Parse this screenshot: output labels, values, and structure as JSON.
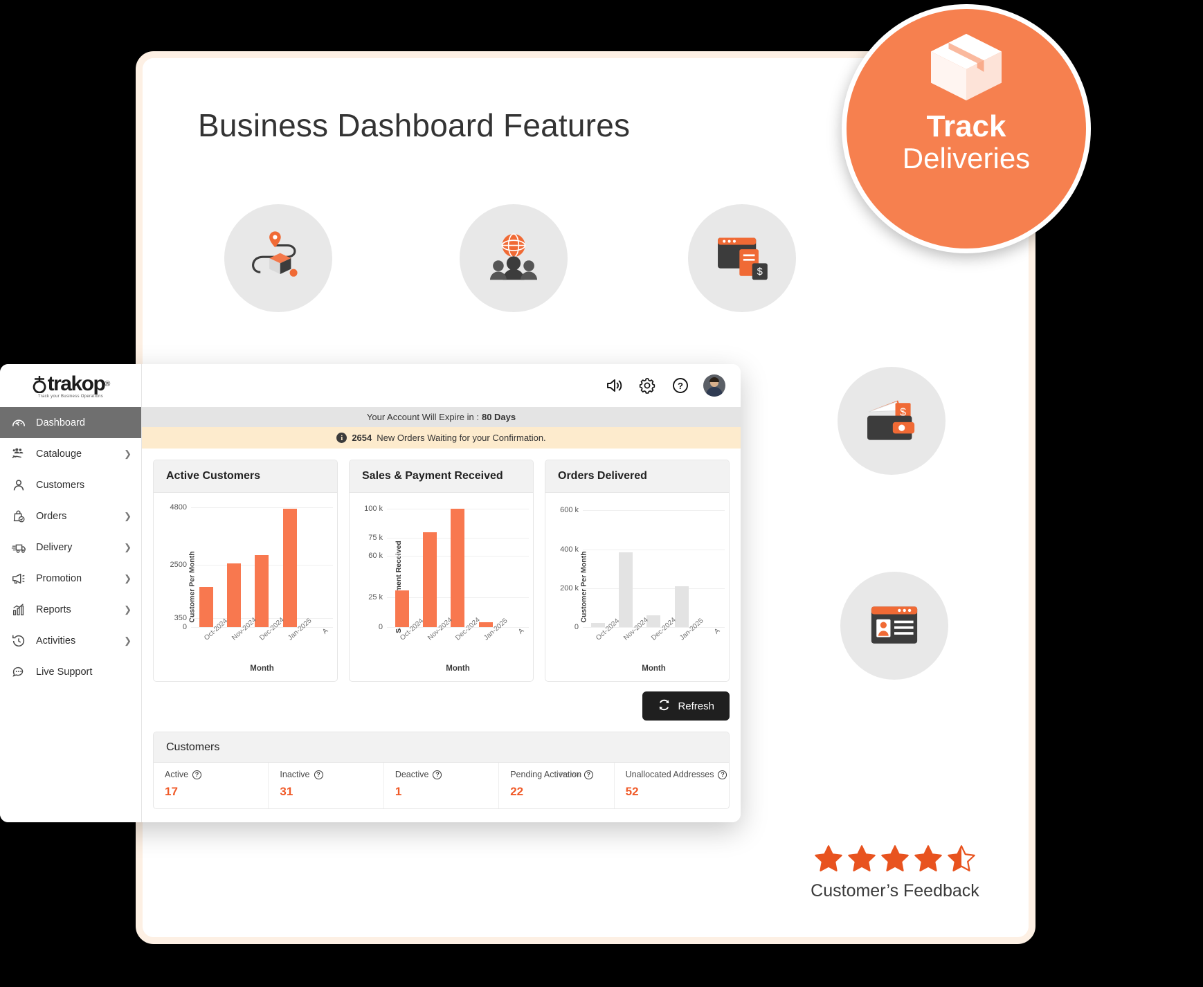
{
  "hero": {
    "title": "Business Dashboard Features"
  },
  "feature_icons": [
    {
      "name": "route-package-icon"
    },
    {
      "name": "global-customers-icon"
    },
    {
      "name": "browser-invoice-icon"
    },
    {
      "name": "wallet-payment-icon"
    },
    {
      "name": "browser-profile-icon"
    }
  ],
  "track_badge": {
    "icon": "package-box-icon",
    "title": "Track",
    "subtitle": "Deliveries",
    "color": "#f6804f"
  },
  "dashboard": {
    "logo": {
      "text": "trakop",
      "registered": "®",
      "tagline": "Track your Business Operations"
    },
    "sidebar": [
      {
        "label": "Dashboard",
        "icon": "dashboard-gauge-icon",
        "chevron": false,
        "active": true
      },
      {
        "label": "Catalouge",
        "icon": "catalogue-hand-icon",
        "chevron": true,
        "active": false
      },
      {
        "label": "Customers",
        "icon": "person-icon",
        "chevron": false,
        "active": false
      },
      {
        "label": "Orders",
        "icon": "bag-check-icon",
        "chevron": true,
        "active": false
      },
      {
        "label": "Delivery",
        "icon": "truck-icon",
        "chevron": true,
        "active": false
      },
      {
        "label": "Promotion",
        "icon": "megaphone-icon",
        "chevron": true,
        "active": false
      },
      {
        "label": "Reports",
        "icon": "bar-chart-icon",
        "chevron": true,
        "active": false
      },
      {
        "label": "Activities",
        "icon": "clock-history-icon",
        "chevron": true,
        "active": false
      },
      {
        "label": "Live Support",
        "icon": "chat-bubble-icon",
        "chevron": false,
        "active": false
      }
    ],
    "topbar_icons": [
      {
        "name": "speaker-announce-icon"
      },
      {
        "name": "gear-settings-icon"
      },
      {
        "name": "help-question-icon"
      },
      {
        "name": "user-avatar"
      }
    ],
    "expire_banner": {
      "text": "Your Account Will Expire in : ",
      "days": "80 Days"
    },
    "orders_banner": {
      "count": "2654",
      "text": "New Orders Waiting for your Confirmation.",
      "icon": "info-icon"
    },
    "refresh_button": {
      "label": "Refresh",
      "icon": "refresh-icon"
    },
    "customers_panel": {
      "title": "Customers",
      "stats": [
        {
          "label": "Active",
          "value": "17",
          "help": "?"
        },
        {
          "label": "Inactive",
          "value": "31",
          "help": "?"
        },
        {
          "label": "Deactive",
          "value": "1",
          "help": "?"
        },
        {
          "label": "Pending Activation",
          "value": "22",
          "help": "?",
          "overlap": "Pre Wa"
        },
        {
          "label": "Unallocated Addresses",
          "value": "52",
          "help": "?"
        }
      ]
    }
  },
  "chart_data": [
    {
      "type": "bar",
      "title": "Active Customers",
      "xlabel": "Month",
      "ylabel": "Customer Per Month",
      "categories": [
        "Oct-2024",
        "Nov-2024",
        "Dec-2024",
        "Jan-2025",
        "A"
      ],
      "values": [
        1600,
        2550,
        2900,
        4750,
        0
      ],
      "yticks": [
        "4800",
        "2500",
        "350",
        "0"
      ],
      "ytick_values": [
        4800,
        2500,
        350,
        0
      ],
      "ylim": [
        0,
        5000
      ],
      "color": "#f8784f",
      "grid": true,
      "legend": false
    },
    {
      "type": "bar",
      "title": "Sales & Payment Received",
      "xlabel": "Month",
      "ylabel": "Sales & Payment Received",
      "categories": [
        "Oct-2024",
        "Nov-2024",
        "Dec-2024",
        "Jan-2025",
        "A"
      ],
      "values": [
        31000,
        80000,
        100000,
        4000,
        0
      ],
      "yticks": [
        "100 k",
        "75 k",
        "60 k",
        "25 k",
        "0"
      ],
      "ytick_values": [
        100000,
        75000,
        60000,
        25000,
        0
      ],
      "ylim": [
        0,
        105000
      ],
      "color": "#f8784f",
      "grid": true,
      "legend": false
    },
    {
      "type": "bar",
      "title": "Orders Delivered",
      "xlabel": "Month",
      "ylabel": "Customer Per Month",
      "categories": [
        "Oct-2024",
        "Nov-2024",
        "Dec-2024",
        "Jan-2025",
        "A"
      ],
      "values": [
        20000,
        385000,
        60000,
        210000,
        0
      ],
      "yticks": [
        "600 k",
        "400 k",
        "200 k",
        "0"
      ],
      "ytick_values": [
        600000,
        400000,
        200000,
        0
      ],
      "ylim": [
        0,
        640000
      ],
      "color": "#e3e3e3",
      "grid": true,
      "legend": false
    }
  ],
  "feedback": {
    "label": "Customer’s Feedback",
    "rating": 4.5,
    "max": 5,
    "star_color": "#e8531f"
  }
}
